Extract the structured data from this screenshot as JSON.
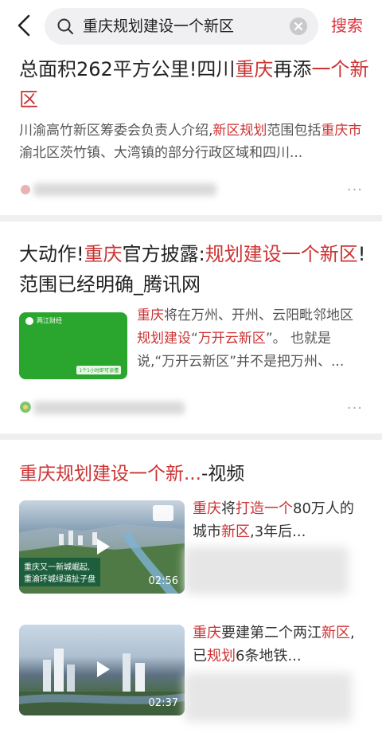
{
  "header": {
    "query": "重庆规划建设一个新区",
    "search_label": "搜索"
  },
  "results": [
    {
      "title_parts": [
        {
          "t": "总面积262平方公里!四川",
          "hl": false
        },
        {
          "t": "重庆",
          "hl": true
        },
        {
          "t": "再添",
          "hl": false
        },
        {
          "t": "一个",
          "hl": true
        },
        {
          "t": "新区",
          "hl": true
        }
      ],
      "abstract_parts": [
        {
          "t": "川渝高竹新区筹委会负责人介绍,",
          "hl": false
        },
        {
          "t": "新区规划",
          "hl": true
        },
        {
          "t": "范围包括",
          "hl": false
        },
        {
          "t": "重庆市",
          "hl": true
        },
        {
          "t": "渝北区茨竹镇、大湾镇的部分行政区域和四川...",
          "hl": false
        }
      ],
      "more": "···"
    },
    {
      "title_parts": [
        {
          "t": "大动作!",
          "hl": false
        },
        {
          "t": "重庆",
          "hl": true
        },
        {
          "t": "官方披露:",
          "hl": false
        },
        {
          "t": "规划建设一个新区",
          "hl": true
        },
        {
          "t": "!范围已经明确_腾讯网",
          "hl": false
        }
      ],
      "thumb_logo": "两江财经",
      "thumb_tag": "1个1小时即可读懂",
      "abstract_parts": [
        {
          "t": "重庆",
          "hl": true
        },
        {
          "t": "将在万州、开州、云阳毗邻地区",
          "hl": false
        },
        {
          "t": "规划建设",
          "hl": true
        },
        {
          "t": "“",
          "hl": false
        },
        {
          "t": "万开云新区",
          "hl": true
        },
        {
          "t": "”。 也就是说,“万开云新区”并不是把万州、...",
          "hl": false
        }
      ],
      "more": "···"
    }
  ],
  "video_section": {
    "title_parts": [
      {
        "t": "重庆规划建设一个新...",
        "hl": true
      },
      {
        "t": "-视频",
        "hl": false
      }
    ],
    "videos": [
      {
        "duration": "02:56",
        "banner_line1": "重庆又一新城崛起,",
        "banner_line2": "重渝环城绿道扯子盘",
        "text_parts": [
          {
            "t": "重庆",
            "hl": true
          },
          {
            "t": "将",
            "hl": false
          },
          {
            "t": "打造一个",
            "hl": true
          },
          {
            "t": "80万人的城市",
            "hl": false
          },
          {
            "t": "新区",
            "hl": true
          },
          {
            "t": ",3年后...",
            "hl": false
          }
        ]
      },
      {
        "duration": "02:37",
        "text_parts": [
          {
            "t": "重庆",
            "hl": true
          },
          {
            "t": "要建第二个两江",
            "hl": false
          },
          {
            "t": "新区",
            "hl": true
          },
          {
            "t": ",已",
            "hl": false
          },
          {
            "t": "规划",
            "hl": true
          },
          {
            "t": "6条地铁...",
            "hl": false
          }
        ]
      }
    ]
  },
  "colors": {
    "highlight": "#cc3333",
    "search_button": "#d9363e",
    "separator": "#efefef",
    "thumb_green": "#2aa52e"
  }
}
